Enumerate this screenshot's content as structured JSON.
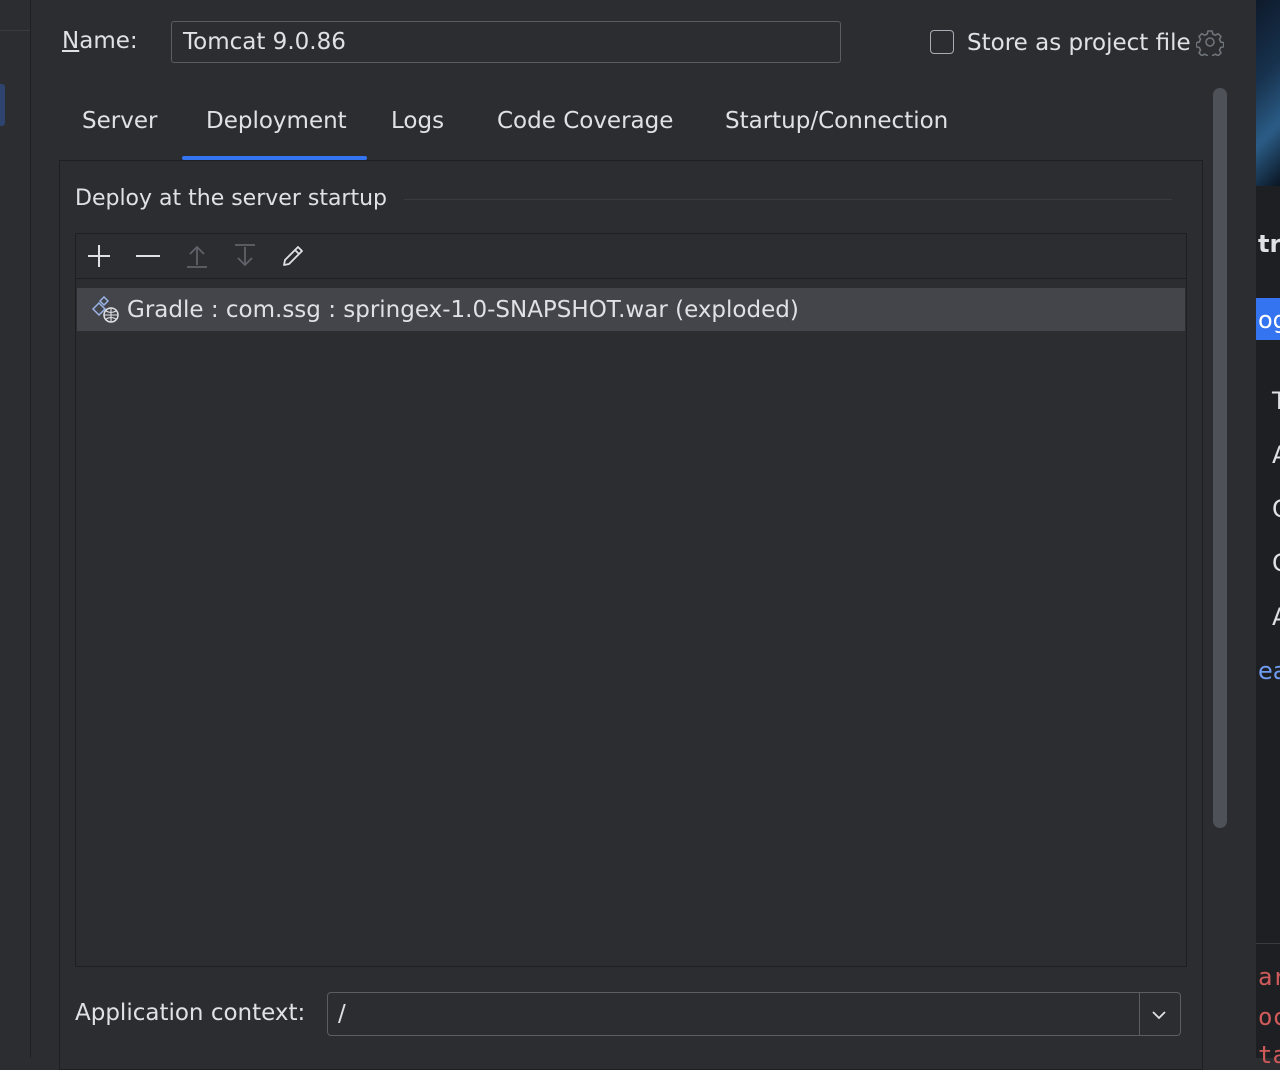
{
  "dialog": {
    "name_label_first": "N",
    "name_label_rest": "ame:",
    "name_value": "Tomcat 9.0.86",
    "store_as_project_file": "Store as project file",
    "store_checked": false
  },
  "tabs": [
    {
      "label": "Server",
      "selected": false
    },
    {
      "label": "Deployment",
      "selected": true
    },
    {
      "label": "Logs",
      "selected": false
    },
    {
      "label": "Code Coverage",
      "selected": false
    },
    {
      "label": "Startup/Connection",
      "selected": false
    }
  ],
  "deployment": {
    "section_title": "Deploy at the server startup",
    "toolbar": [
      "add-icon",
      "remove-icon",
      "move-up-icon",
      "move-down-icon",
      "edit-icon"
    ],
    "artifacts": [
      {
        "label": "Gradle : com.ssg : springex-1.0-SNAPSHOT.war (exploded)",
        "icon": "web-artifact-icon",
        "selected": true
      }
    ],
    "app_context_label": "Application context:",
    "app_context_value": "/"
  },
  "background_window": {
    "fragments": [
      "tr",
      "og",
      "T",
      "A",
      "C",
      "C",
      "A",
      "ear",
      "ar",
      "oc",
      "ta"
    ]
  },
  "colors": {
    "background": "#2b2d30",
    "accent": "#3574f0",
    "selection": "#43454a",
    "text": "#dfe1e5"
  }
}
